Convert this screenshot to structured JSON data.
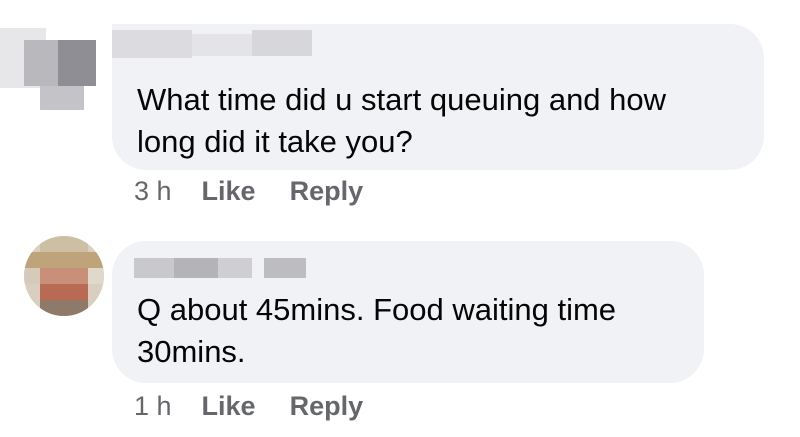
{
  "comments": [
    {
      "author": "",
      "text": "What time did u start queuing and how\nlong did it take you?",
      "time": "3 h",
      "like_label": "Like",
      "reply_label": "Reply"
    },
    {
      "author": "",
      "text": "Q about 45mins. Food waiting time\n30mins.",
      "time": "1 h",
      "like_label": "Like",
      "reply_label": "Reply"
    }
  ],
  "colors": {
    "bubble_bg": "#f0f2f5",
    "text": "#050505",
    "meta": "#65676b"
  }
}
